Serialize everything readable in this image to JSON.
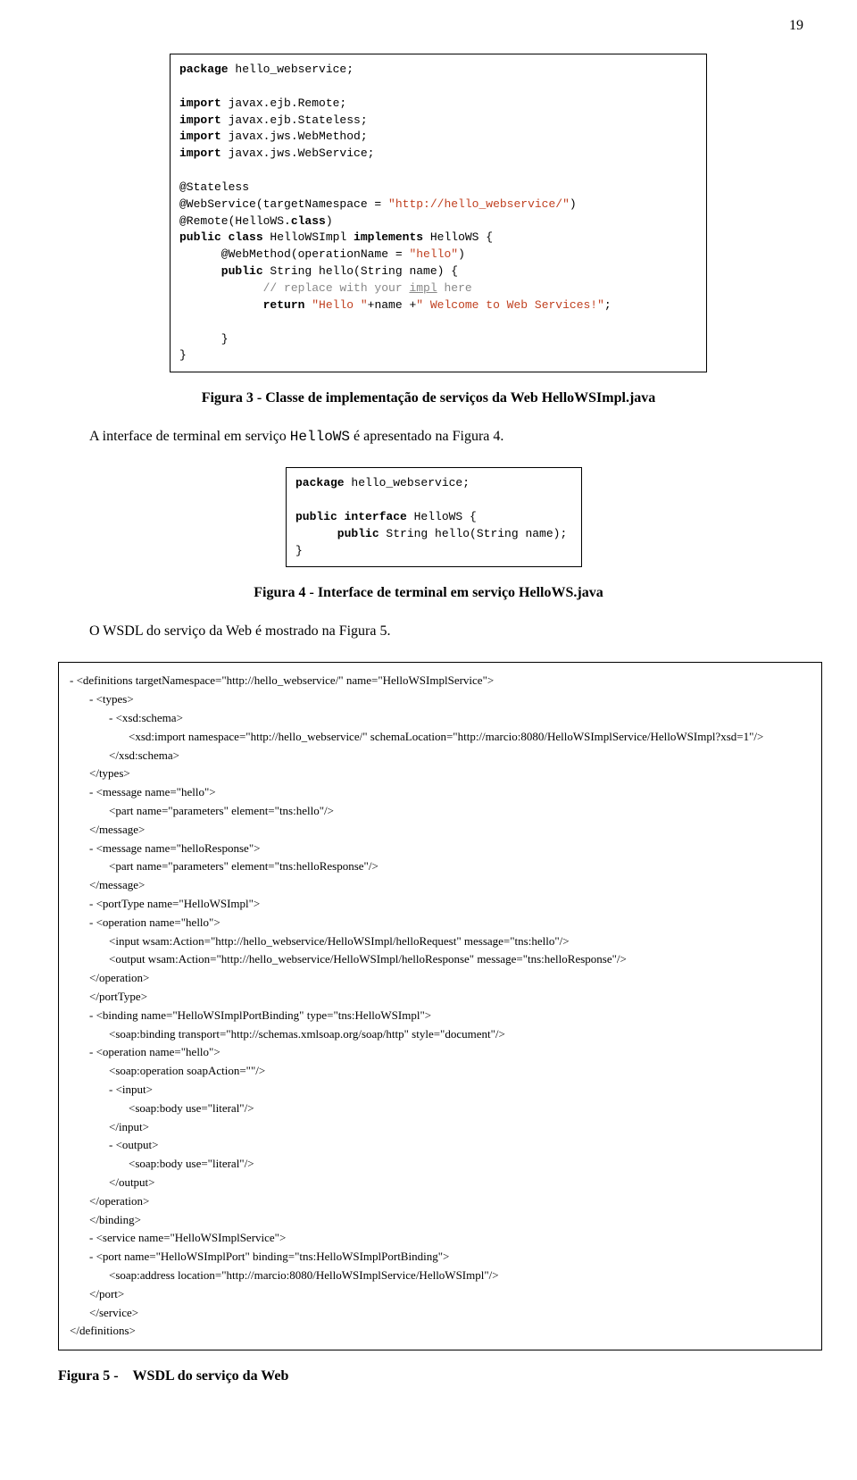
{
  "page_number": "19",
  "code1": {
    "l1a": "package",
    "l1b": " hello_webservice;",
    "l2a": "import",
    "l2b": " javax.ejb.Remote;",
    "l3a": "import",
    "l3b": " javax.ejb.Stateless;",
    "l4a": "import",
    "l4b": " javax.jws.WebMethod;",
    "l5a": "import",
    "l5b": " javax.jws.WebService;",
    "l6": "@Stateless",
    "l7a": "@WebService(targetNamespace = ",
    "l7b": "\"http://hello_webservice/\"",
    "l7c": ")",
    "l8a": "@Remote(HelloWS.",
    "l8b": "class",
    "l8c": ")",
    "l9a": "public class",
    "l9b": " HelloWSImpl ",
    "l9c": "implements",
    "l9d": " HelloWS {",
    "l10a": "      @WebMethod(operationName = ",
    "l10b": "\"hello\"",
    "l10c": ")",
    "l11a": "      public",
    "l11b": " String hello(String name) {",
    "l12": "            // replace with your ",
    "l12u": "impl",
    "l12e": " here",
    "l13a": "            return ",
    "l13b": "\"Hello \"",
    "l13c": "+name +",
    "l13d": "\" Welcome to Web Services!\"",
    "l13e": ";",
    "l14": "      }",
    "l15": "}"
  },
  "caption3_bold": "Figura 3 - Classe de implementação de serviços da Web HelloWSImpl.java",
  "para1_a": "A interface de terminal em serviço ",
  "para1_code": "HelloWS",
  "para1_b": " é apresentado na Figura 4.",
  "code2": {
    "l1a": "package",
    "l1b": " hello_webservice;",
    "l2a": "public interface",
    "l2b": " HelloWS {",
    "l3a": "      public",
    "l3b": " String hello(String name);",
    "l4": "}"
  },
  "caption4_bold": "Figura 4 - Interface de terminal em serviço HelloWS.java",
  "para2": "O WSDL do serviço da Web é mostrado na Figura 5.",
  "wsdl": {
    "l1": "- <definitions targetNamespace=\"http://hello_webservice/\" name=\"HelloWSImplService\">",
    "l2": "- <types>",
    "l3": "- <xsd:schema>",
    "l4": "<xsd:import namespace=\"http://hello_webservice/\" schemaLocation=\"http://marcio:8080/HelloWSImplService/HelloWSImpl?xsd=1\"/>",
    "l5": "</xsd:schema>",
    "l6": "</types>",
    "l7": "- <message name=\"hello\">",
    "l8": "<part name=\"parameters\" element=\"tns:hello\"/>",
    "l9": "</message>",
    "l10": "- <message name=\"helloResponse\">",
    "l11": "<part name=\"parameters\" element=\"tns:helloResponse\"/>",
    "l12": "</message>",
    "l13": "- <portType name=\"HelloWSImpl\">",
    "l14": "- <operation name=\"hello\">",
    "l15": "<input wsam:Action=\"http://hello_webservice/HelloWSImpl/helloRequest\" message=\"tns:hello\"/>",
    "l16": "<output wsam:Action=\"http://hello_webservice/HelloWSImpl/helloResponse\" message=\"tns:helloResponse\"/>",
    "l17": "</operation>",
    "l18": "</portType>",
    "l19": "- <binding name=\"HelloWSImplPortBinding\" type=\"tns:HelloWSImpl\">",
    "l20": "<soap:binding transport=\"http://schemas.xmlsoap.org/soap/http\" style=\"document\"/>",
    "l21": "- <operation name=\"hello\">",
    "l22": "<soap:operation soapAction=\"\"/>",
    "l23": "- <input>",
    "l24": "<soap:body use=\"literal\"/>",
    "l25": "</input>",
    "l26": "- <output>",
    "l27": "<soap:body use=\"literal\"/>",
    "l28": "</output>",
    "l29": "</operation>",
    "l30": "</binding>",
    "l31": "- <service name=\"HelloWSImplService\">",
    "l32": "- <port name=\"HelloWSImplPort\" binding=\"tns:HelloWSImplPortBinding\">",
    "l33": "<soap:address location=\"http://marcio:8080/HelloWSImplService/HelloWSImpl\"/>",
    "l34": "</port>",
    "l35": "</service>",
    "l36": "</definitions>"
  },
  "caption5_a": "Figura 5 - ",
  "caption5_b": "WSDL do serviço da Web"
}
